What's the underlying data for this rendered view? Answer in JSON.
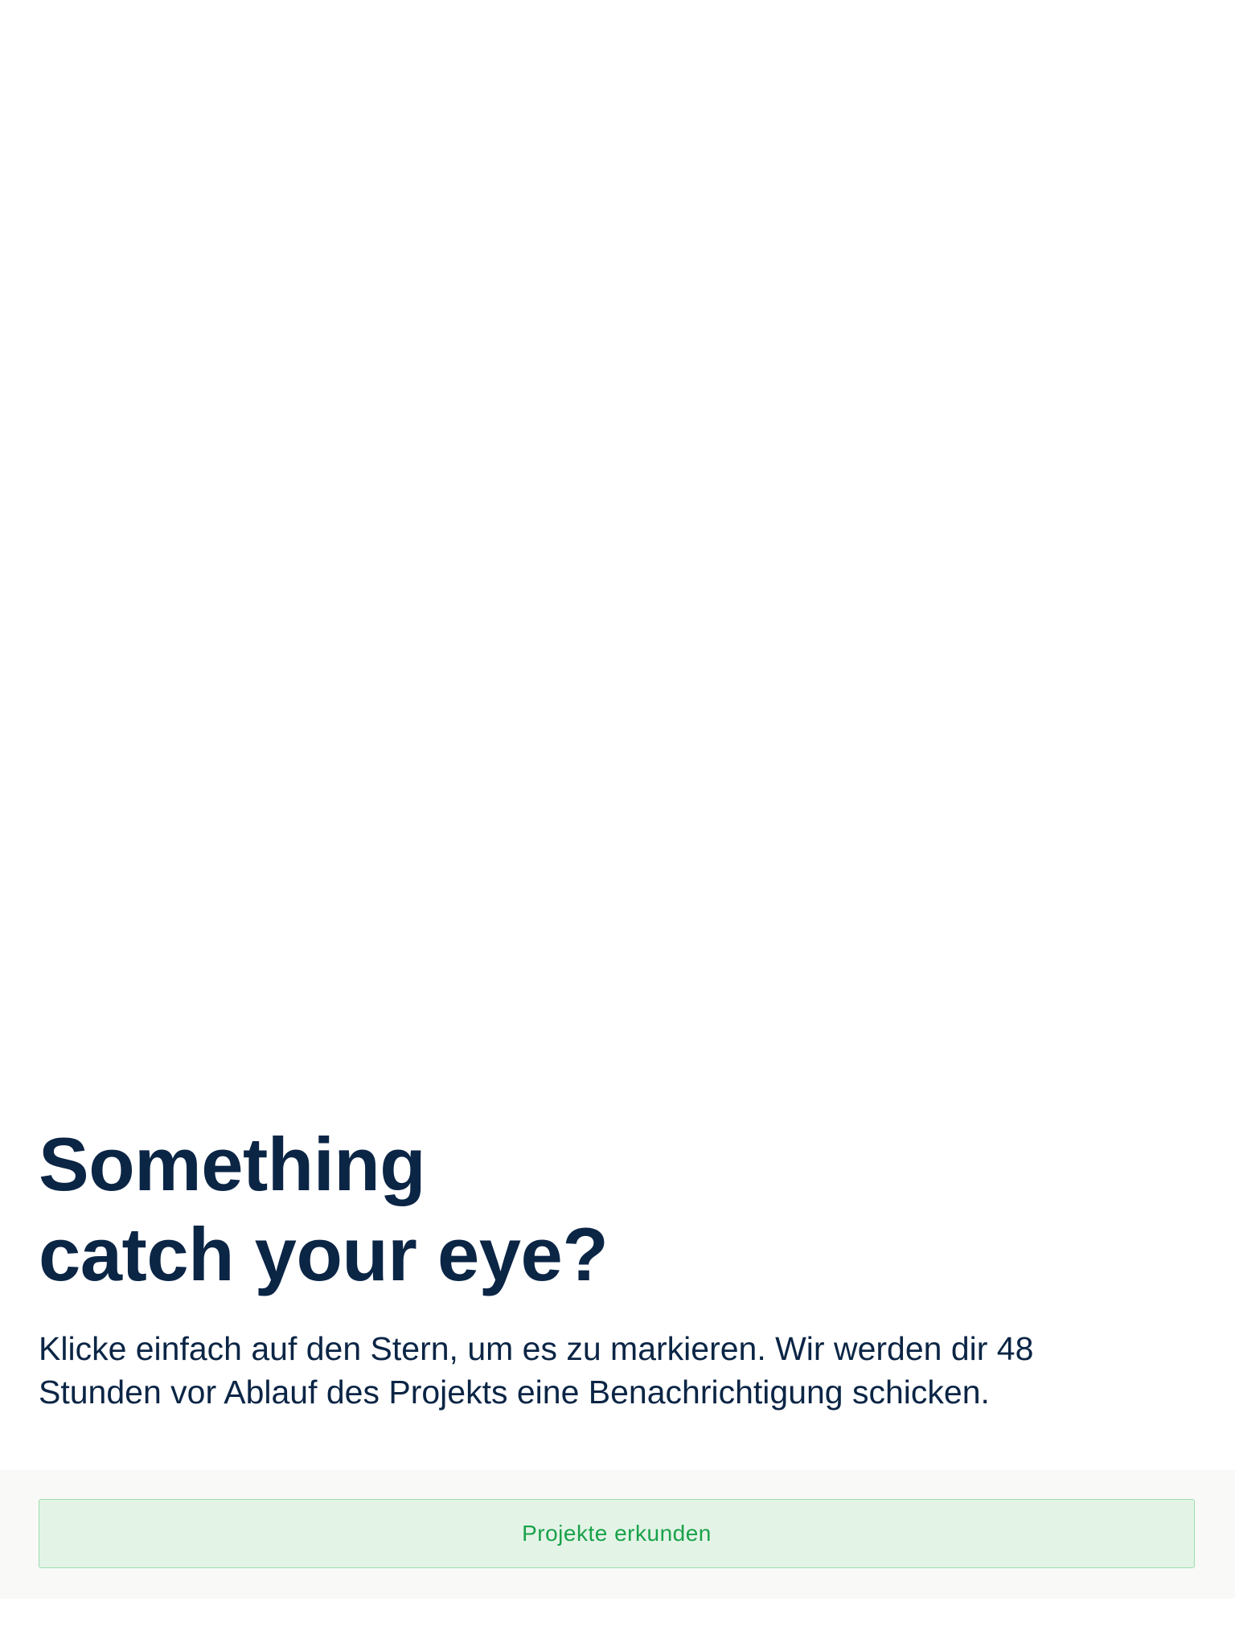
{
  "onboarding": {
    "headline_line1": "Something",
    "headline_line2": "catch your eye?",
    "description": "Klicke einfach auf den Stern, um es zu markieren. Wir werden dir 48 Stunden vor Ablauf des Projekts eine Benachrichtigung schicken."
  },
  "footer": {
    "explore_button_label": "Projekte erkunden"
  },
  "colors": {
    "headline": "#0b2545",
    "button_text": "#1aa14a",
    "button_background": "#e3f4e7",
    "button_border": "#9fdcb0",
    "footer_background": "#f9f9f7"
  }
}
